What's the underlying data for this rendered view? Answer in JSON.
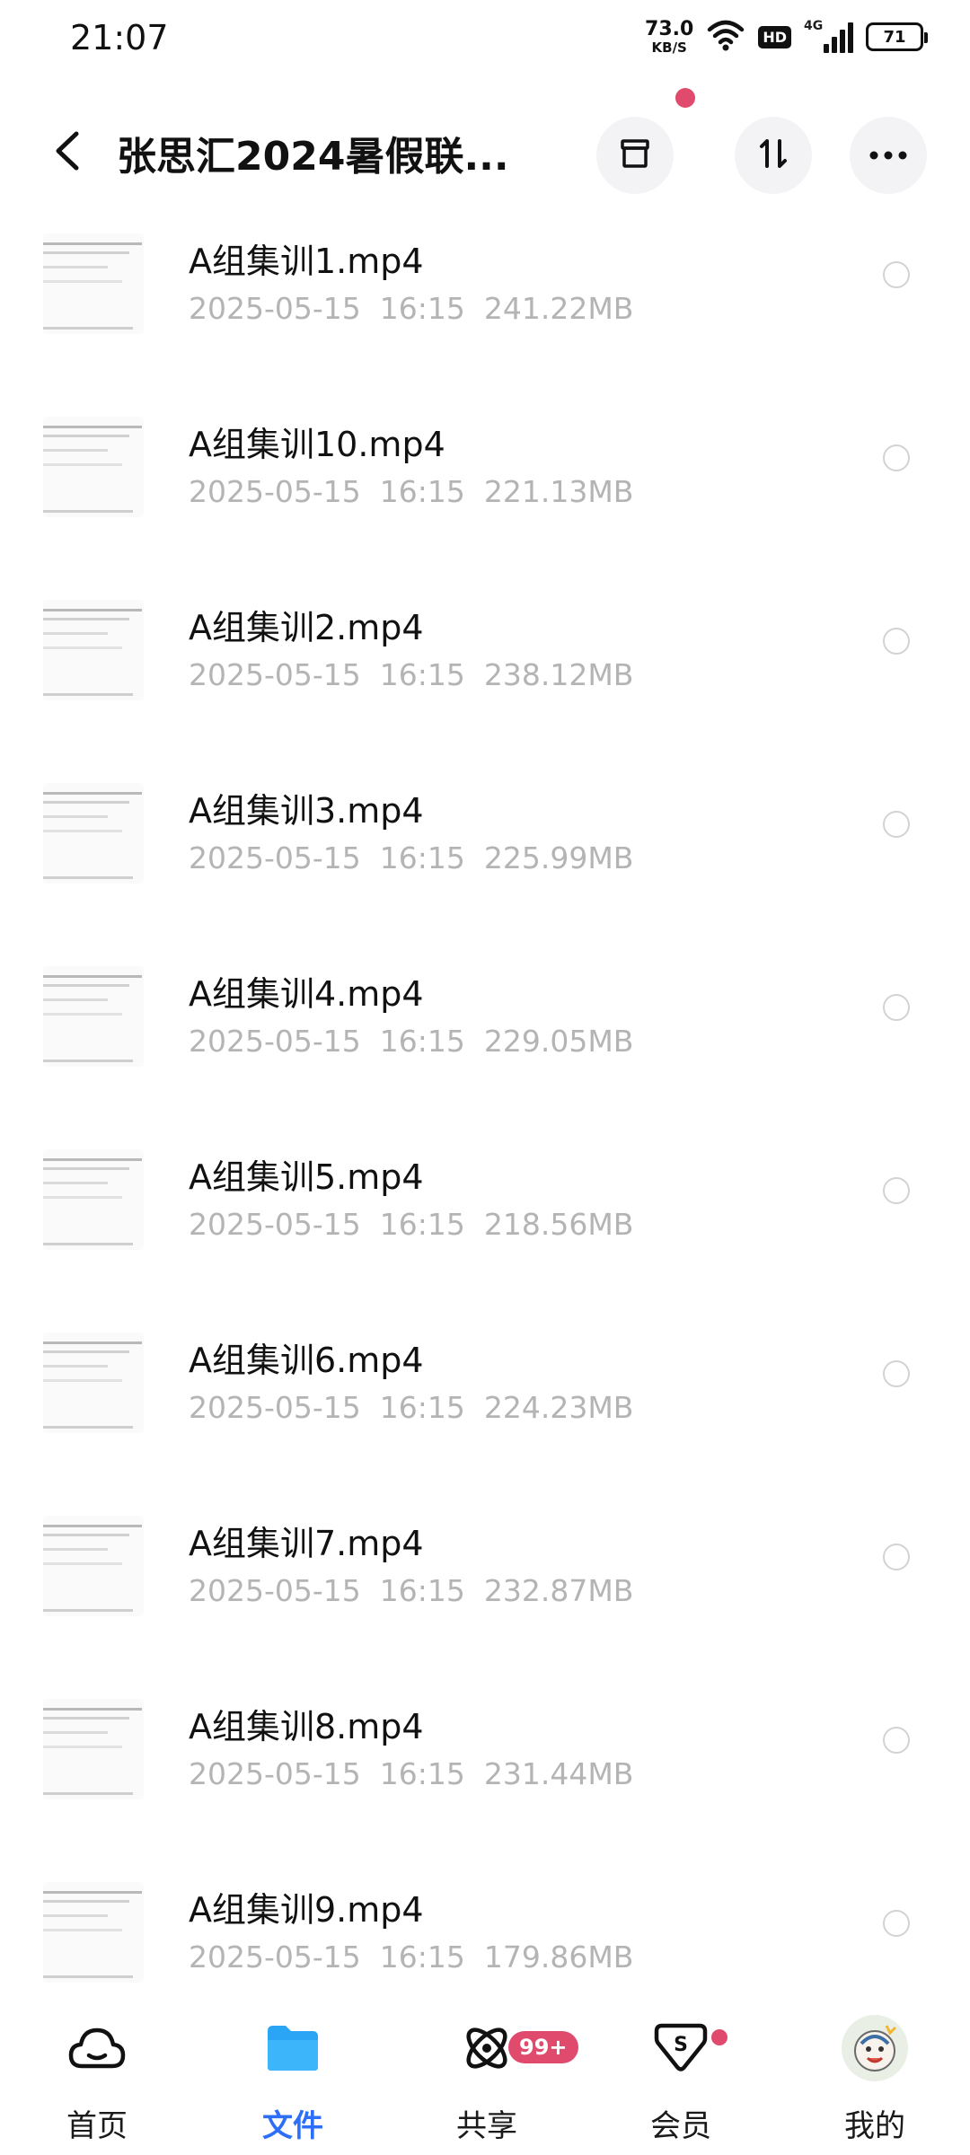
{
  "status_bar": {
    "time": "21:07",
    "net_speed_value": "73.0",
    "net_speed_unit": "KB/S",
    "hd": "HD",
    "network": "4G",
    "battery": "71"
  },
  "header": {
    "title": "张思汇2024暑假联..."
  },
  "files": [
    {
      "name": "A组集训1.mp4",
      "date": "2025-05-15",
      "time": "16:15",
      "size": "241.22MB"
    },
    {
      "name": "A组集训10.mp4",
      "date": "2025-05-15",
      "time": "16:15",
      "size": "221.13MB"
    },
    {
      "name": "A组集训2.mp4",
      "date": "2025-05-15",
      "time": "16:15",
      "size": "238.12MB"
    },
    {
      "name": "A组集训3.mp4",
      "date": "2025-05-15",
      "time": "16:15",
      "size": "225.99MB"
    },
    {
      "name": "A组集训4.mp4",
      "date": "2025-05-15",
      "time": "16:15",
      "size": "229.05MB"
    },
    {
      "name": "A组集训5.mp4",
      "date": "2025-05-15",
      "time": "16:15",
      "size": "218.56MB"
    },
    {
      "name": "A组集训6.mp4",
      "date": "2025-05-15",
      "time": "16:15",
      "size": "224.23MB"
    },
    {
      "name": "A组集训7.mp4",
      "date": "2025-05-15",
      "time": "16:15",
      "size": "232.87MB"
    },
    {
      "name": "A组集训8.mp4",
      "date": "2025-05-15",
      "time": "16:15",
      "size": "231.44MB"
    },
    {
      "name": "A组集训9.mp4",
      "date": "2025-05-15",
      "time": "16:15",
      "size": "179.86MB"
    }
  ],
  "bottom_nav": {
    "items": [
      {
        "label": "首页",
        "icon": "home-cloud-icon"
      },
      {
        "label": "文件",
        "icon": "folder-icon",
        "active": true
      },
      {
        "label": "共享",
        "icon": "share-orbit-icon"
      },
      {
        "label": "会员",
        "icon": "vip-diamond-icon"
      },
      {
        "label": "我的",
        "icon": "avatar-icon"
      }
    ],
    "share_badge": "99+"
  },
  "colors": {
    "accent": "#2d6ff7",
    "badge": "#e04a6d",
    "meta_text": "#b4b4b4"
  }
}
